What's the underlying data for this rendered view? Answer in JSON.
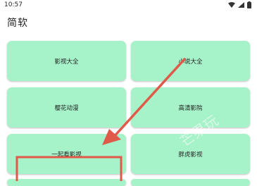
{
  "status_bar": {
    "time": "10:57"
  },
  "app_title": "简软",
  "tiles": [
    {
      "label": "影视大全"
    },
    {
      "label": "小说大全"
    },
    {
      "label": "樱花动漫"
    },
    {
      "label": "高清影院"
    },
    {
      "label": "一起看影视"
    },
    {
      "label": "胖虎影视"
    }
  ],
  "watermark": "芒果玩",
  "colors": {
    "tile": "#a6f2c9",
    "annotation": "#e05a4a"
  }
}
